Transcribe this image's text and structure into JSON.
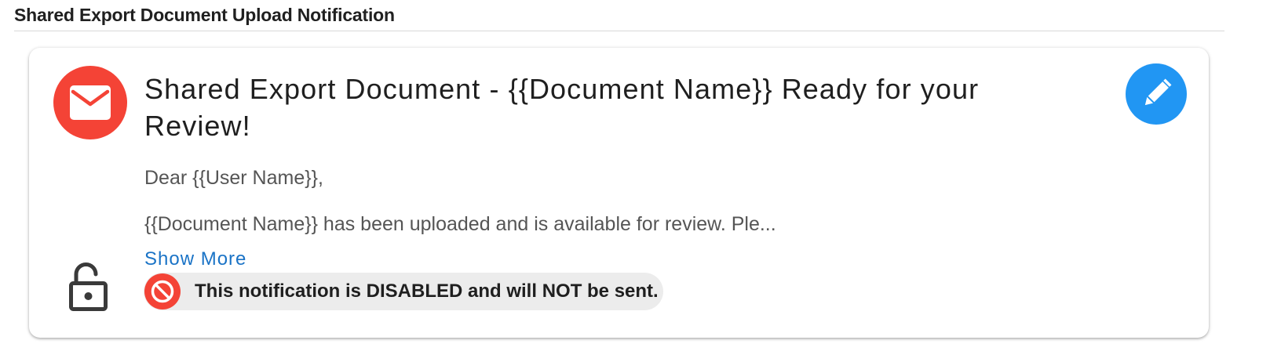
{
  "section": {
    "title": "Shared Export Document Upload Notification"
  },
  "card": {
    "title": "Shared Export Document - {{Document Name}} Ready for your Review!",
    "greeting": "Dear {{User Name}},",
    "body_preview": "{{Document Name}} has been uploaded and is available for review. Ple...",
    "show_more_label": "Show More",
    "status_text": "This notification is DISABLED and will NOT be sent.",
    "icons": {
      "avatar": "mail-icon",
      "edit": "pencil-icon",
      "lock": "unlocked-lock-icon",
      "status": "block-icon"
    }
  },
  "colors": {
    "avatar_bg": "#f44336",
    "edit_bg": "#2196f3",
    "link": "#1a73c6",
    "status_icon_bg": "#f44336",
    "status_chip_bg": "#ececec"
  }
}
